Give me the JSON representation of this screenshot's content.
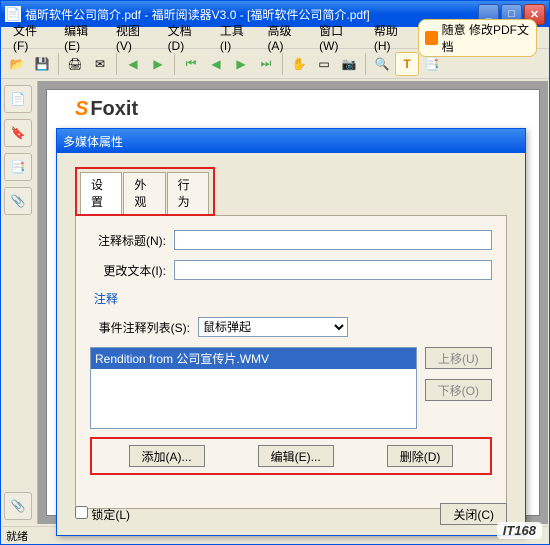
{
  "window": {
    "title": "福昕软件公司简介.pdf - 福昕阅读器V3.0 - [福昕软件公司简介.pdf]",
    "min": "_",
    "max": "□",
    "close": "✕"
  },
  "menu": {
    "file": "文件(F)",
    "edit": "编辑(E)",
    "view": "视图(V)",
    "doc": "文档(D)",
    "tools": "工具(I)",
    "adv": "高级(A)",
    "window": "窗口(W)",
    "help": "帮助(H)"
  },
  "promo": {
    "text": "随意 修改PDF文档"
  },
  "sidebar": {
    "thumb": "📄",
    "bookmark": "🔖",
    "layer": "📑",
    "attach": "📎"
  },
  "doc": {
    "logo_prefix": "S",
    "logo_text": "Foxit"
  },
  "statusbar": {
    "ready": "就绪"
  },
  "dialog": {
    "title": "多媒体属性",
    "tabs": {
      "settings": "设置",
      "appearance": "外观",
      "behavior": "行为"
    },
    "labels": {
      "comment_title": "注释标题(N):",
      "change_text": "更改文本(I):",
      "comments": "注释",
      "event_list": "事件注释列表(S):"
    },
    "event_selected": "鼠标弹起",
    "list_item": "Rendition from 公司宣传片.WMV",
    "side_buttons": {
      "up": "上移(U)",
      "down": "下移(O)"
    },
    "action_buttons": {
      "add": "添加(A)...",
      "edit": "编辑(E)...",
      "delete": "删除(D)"
    },
    "lock": "锁定(L)",
    "close": "关闭(C)"
  },
  "watermark": "IT168"
}
